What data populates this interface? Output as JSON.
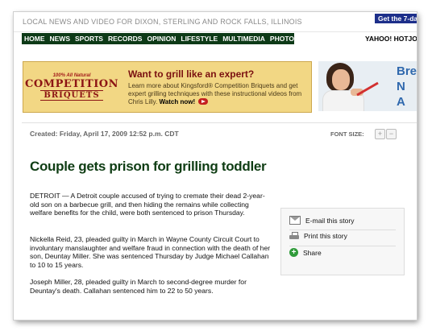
{
  "header": {
    "tagline": "LOCAL NEWS AND VIDEO FOR DIXON, STERLING AND ROCK FALLS, ILLINOIS",
    "promo": "Get the 7-da",
    "partner": "YAHOO! HOTJO"
  },
  "nav": {
    "items": [
      "HOME",
      "NEWS",
      "SPORTS",
      "RECORDS",
      "OPINION",
      "LIFESTYLE",
      "MULTIMEDIA",
      "PHOTOS"
    ]
  },
  "ad": {
    "logo_top": "100% All Natural",
    "logo_main": "COMPETITION",
    "logo_sub": "BRIQUETS",
    "headline": "Want to grill like an expert?",
    "body": "Learn more about Kingsford® Competition Briquets and get expert grilling techniques with these instructional videos from Chris Lilly.",
    "cta": "Watch now!"
  },
  "ad2": {
    "letters": [
      "Bre",
      "N",
      "A"
    ]
  },
  "article": {
    "created": "Created: Friday, April 17, 2009 12:52 p.m. CDT",
    "font_size_label": "FONT SIZE:",
    "font_plus": "+",
    "font_minus": "−",
    "headline": "Couple gets prison for grilling toddler",
    "paragraphs": [
      "DETROIT — A Detroit couple accused of trying to cremate their dead 2-year-old son on a barbecue grill, and then hiding the remains while collecting welfare benefits for the child, were both sentenced to prison Thursday.",
      "Nickella Reid, 23, pleaded guilty in March in Wayne County Circuit Court to involuntary manslaughter and welfare fraud in connection with the death of her son, Deuntay Miller. She was sentenced Thursday by Judge Michael Callahan to 10 to 15 years.",
      "Joseph Miller, 28, pleaded guilty in March to second-degree murder for Deuntay's death. Callahan sentenced him to 22 to 50 years."
    ]
  },
  "share": {
    "email": "E-mail this story",
    "print": "Print this story",
    "share": "Share"
  },
  "colors": {
    "nav_bg": "#0d3a17",
    "headline": "#0f3d14",
    "promo_bg": "#1d2f8a"
  }
}
